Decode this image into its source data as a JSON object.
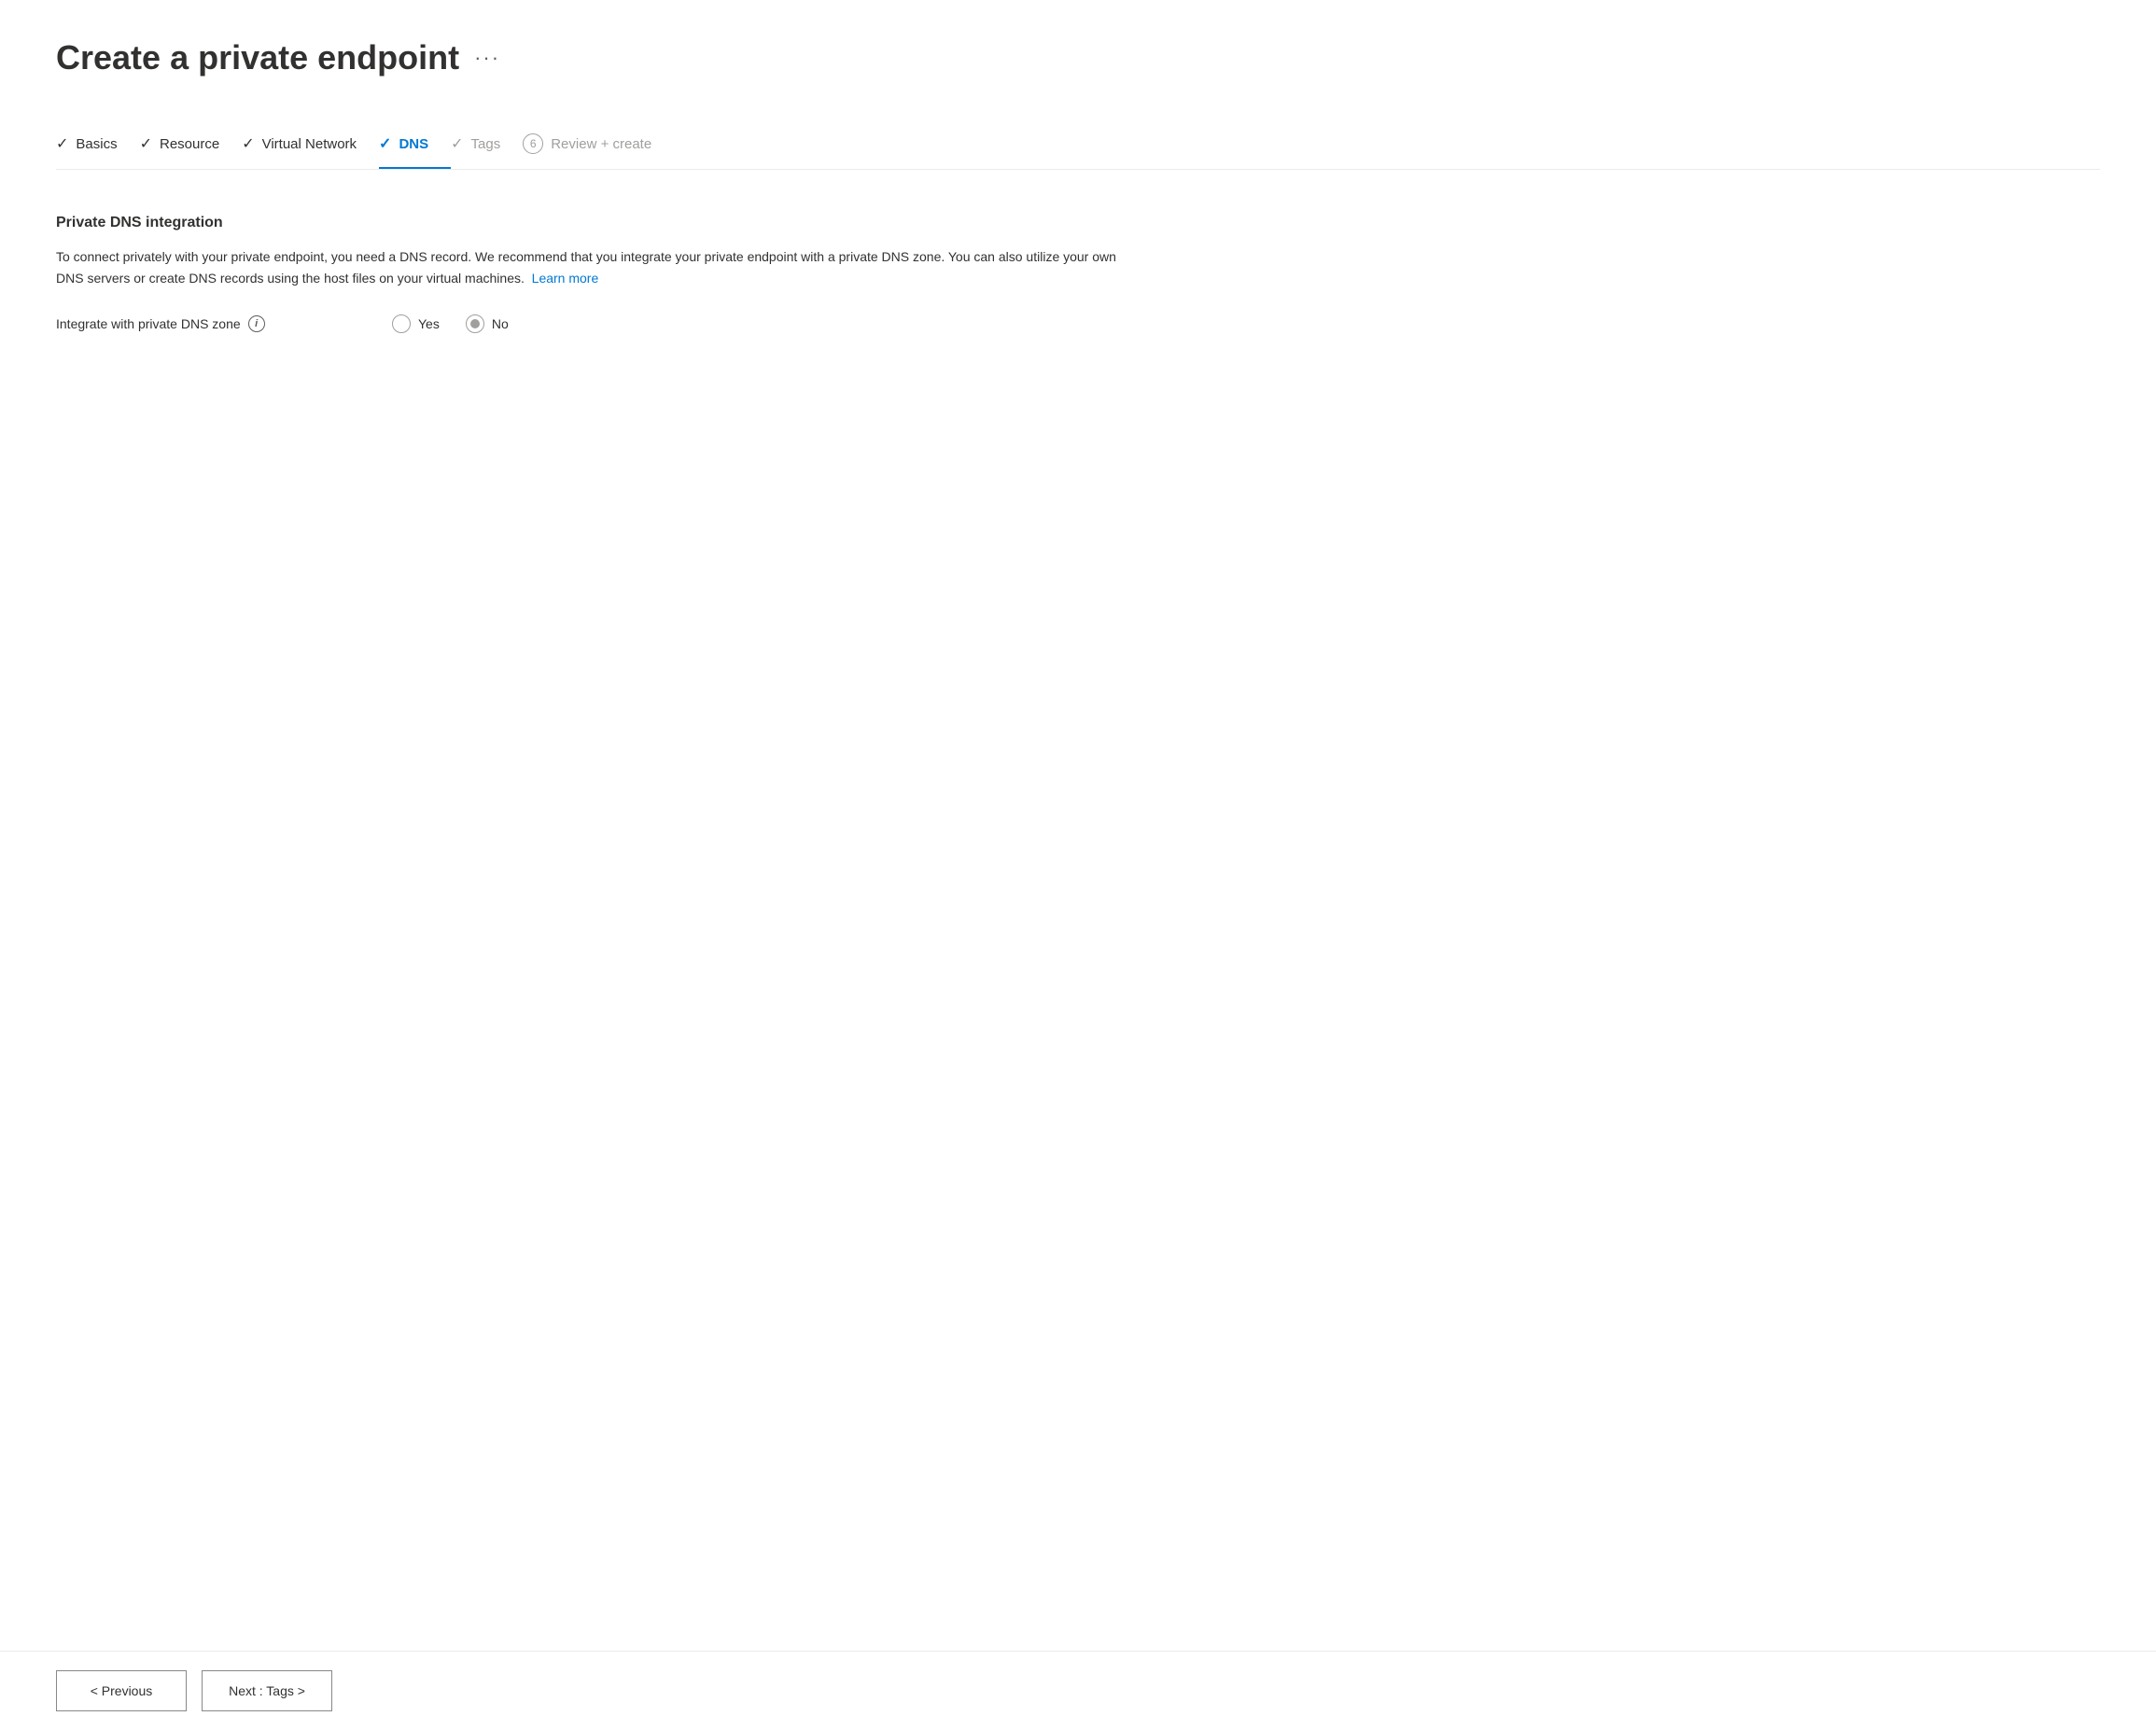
{
  "page": {
    "title": "Create a private endpoint",
    "ellipsis": "···"
  },
  "wizard": {
    "steps": [
      {
        "id": "basics",
        "label": "Basics",
        "state": "completed",
        "icon": "✓",
        "number": null
      },
      {
        "id": "resource",
        "label": "Resource",
        "state": "completed",
        "icon": "✓",
        "number": null
      },
      {
        "id": "virtual-network",
        "label": "Virtual Network",
        "state": "completed",
        "icon": "✓",
        "number": null
      },
      {
        "id": "dns",
        "label": "DNS",
        "state": "active",
        "icon": "✓",
        "number": null
      },
      {
        "id": "tags",
        "label": "Tags",
        "state": "disabled",
        "icon": "✓",
        "number": null
      },
      {
        "id": "review-create",
        "label": "Review + create",
        "state": "disabled",
        "icon": null,
        "number": "6"
      }
    ]
  },
  "content": {
    "section_title": "Private DNS integration",
    "description": "To connect privately with your private endpoint, you need a DNS record. We recommend that you integrate your private endpoint with a private DNS zone. You can also utilize your own DNS servers or create DNS records using the host files on your virtual machines.",
    "learn_more_text": "Learn more",
    "form": {
      "label": "Integrate with private DNS zone",
      "options": [
        {
          "id": "yes",
          "label": "Yes",
          "selected": false
        },
        {
          "id": "no",
          "label": "No",
          "selected": true
        }
      ]
    }
  },
  "footer": {
    "previous_label": "< Previous",
    "next_label": "Next : Tags >"
  }
}
